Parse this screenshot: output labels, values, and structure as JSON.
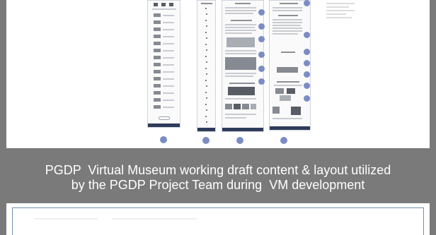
{
  "caption": {
    "line1": "PGDP  Virtual Museum working draft content & layout utilized",
    "line2": "by the PGDP Project Team during  VM development"
  },
  "colors": {
    "background": "#7a7a7a",
    "page": "#ffffff",
    "sheet_footer": "#2e3b5b",
    "marker": "#7b8bc4"
  },
  "icons": {
    "section_marker": "circle"
  }
}
